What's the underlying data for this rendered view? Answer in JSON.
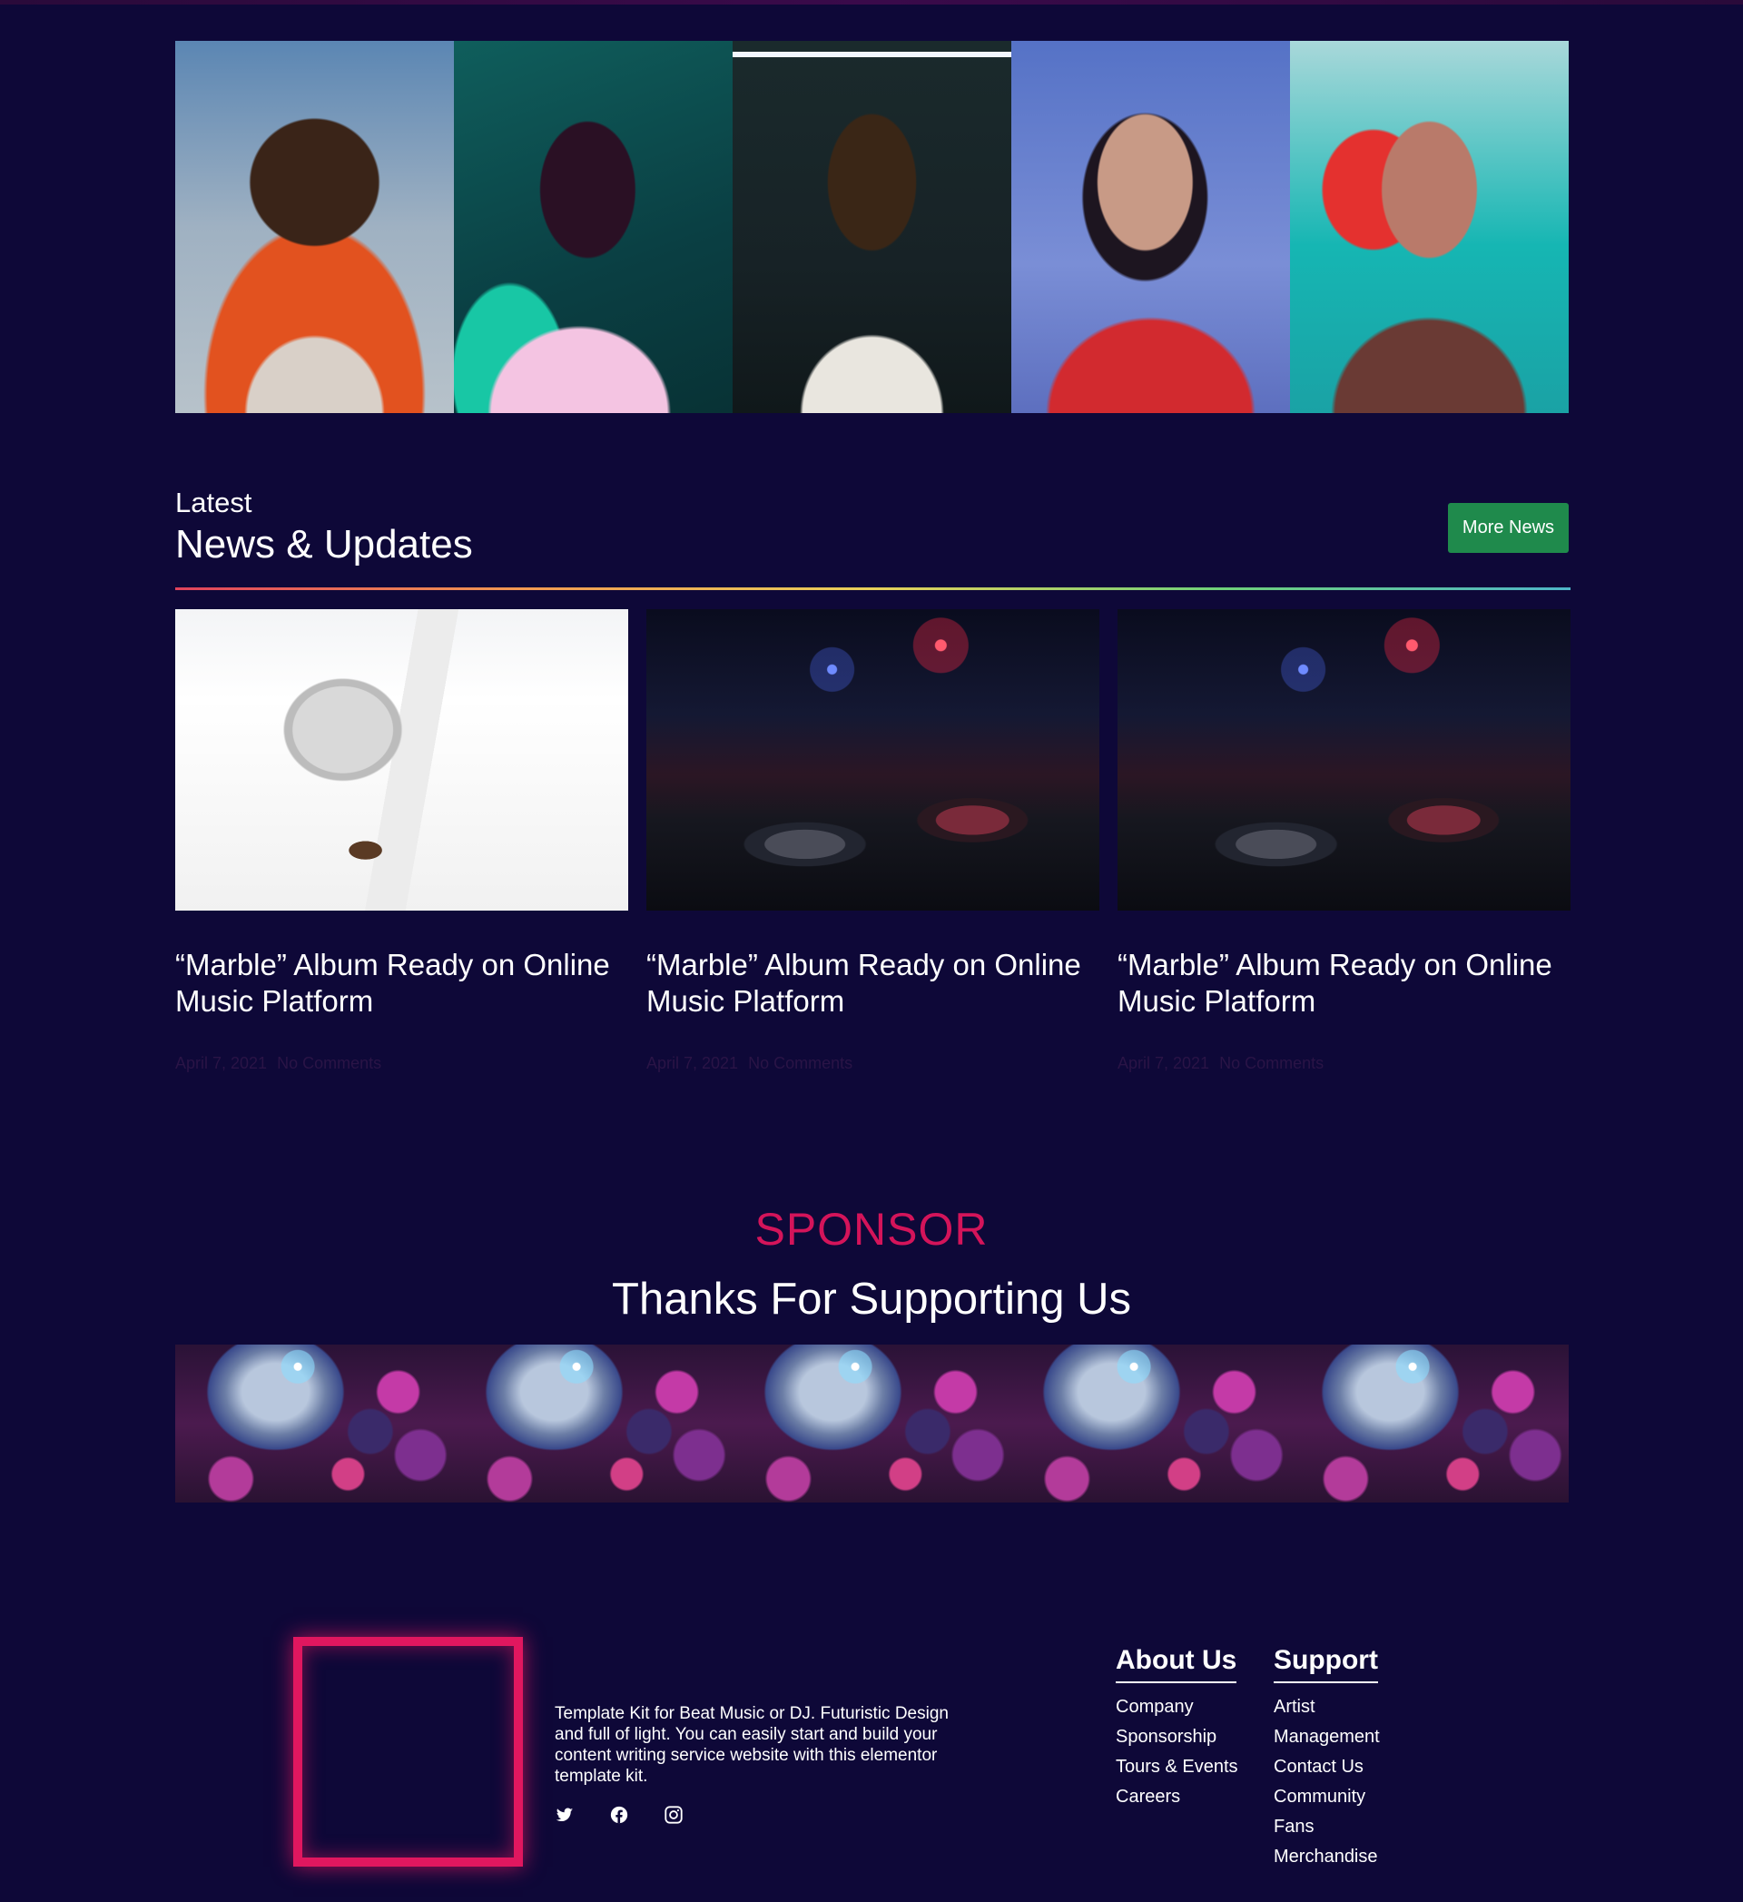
{
  "artists": [
    {
      "name": "artist-1"
    },
    {
      "name": "artist-2"
    },
    {
      "name": "artist-3"
    },
    {
      "name": "artist-4"
    },
    {
      "name": "artist-5"
    }
  ],
  "news": {
    "kicker": "Latest",
    "title": "News & Updates",
    "more_button": "More News",
    "posts": [
      {
        "title": "“Marble” Album Ready on Online Music Platform",
        "date": "April 7, 2021",
        "comments": "No Comments"
      },
      {
        "title": "“Marble” Album Ready on Online Music Platform",
        "date": "April 7, 2021",
        "comments": "No Comments"
      },
      {
        "title": "“Marble” Album Ready on Online Music Platform",
        "date": "April 7, 2021",
        "comments": "No Comments"
      }
    ]
  },
  "sponsor": {
    "kicker": "SPONSOR",
    "title": "Thanks For Supporting Us"
  },
  "footer": {
    "description": "Template Kit for Beat Music or DJ. Futuristic Design and full of light. You can easily start and build your content writing service website with this elementor template kit.",
    "socials": [
      "twitter-icon",
      "facebook-icon",
      "instagram-icon"
    ],
    "about": {
      "heading": "About Us",
      "links": [
        "Company",
        "Sponsorship",
        "Tours & Events",
        "Careers"
      ]
    },
    "support": {
      "heading": "Support",
      "links": [
        "Artist",
        "Management",
        "Contact Us",
        "Community",
        "Fans",
        "Merchandise"
      ]
    }
  },
  "colors": {
    "background": "#0e0838",
    "accent_pink": "#d4145a",
    "button_green": "#1f8a4c",
    "meta_text": "#2a1446"
  }
}
